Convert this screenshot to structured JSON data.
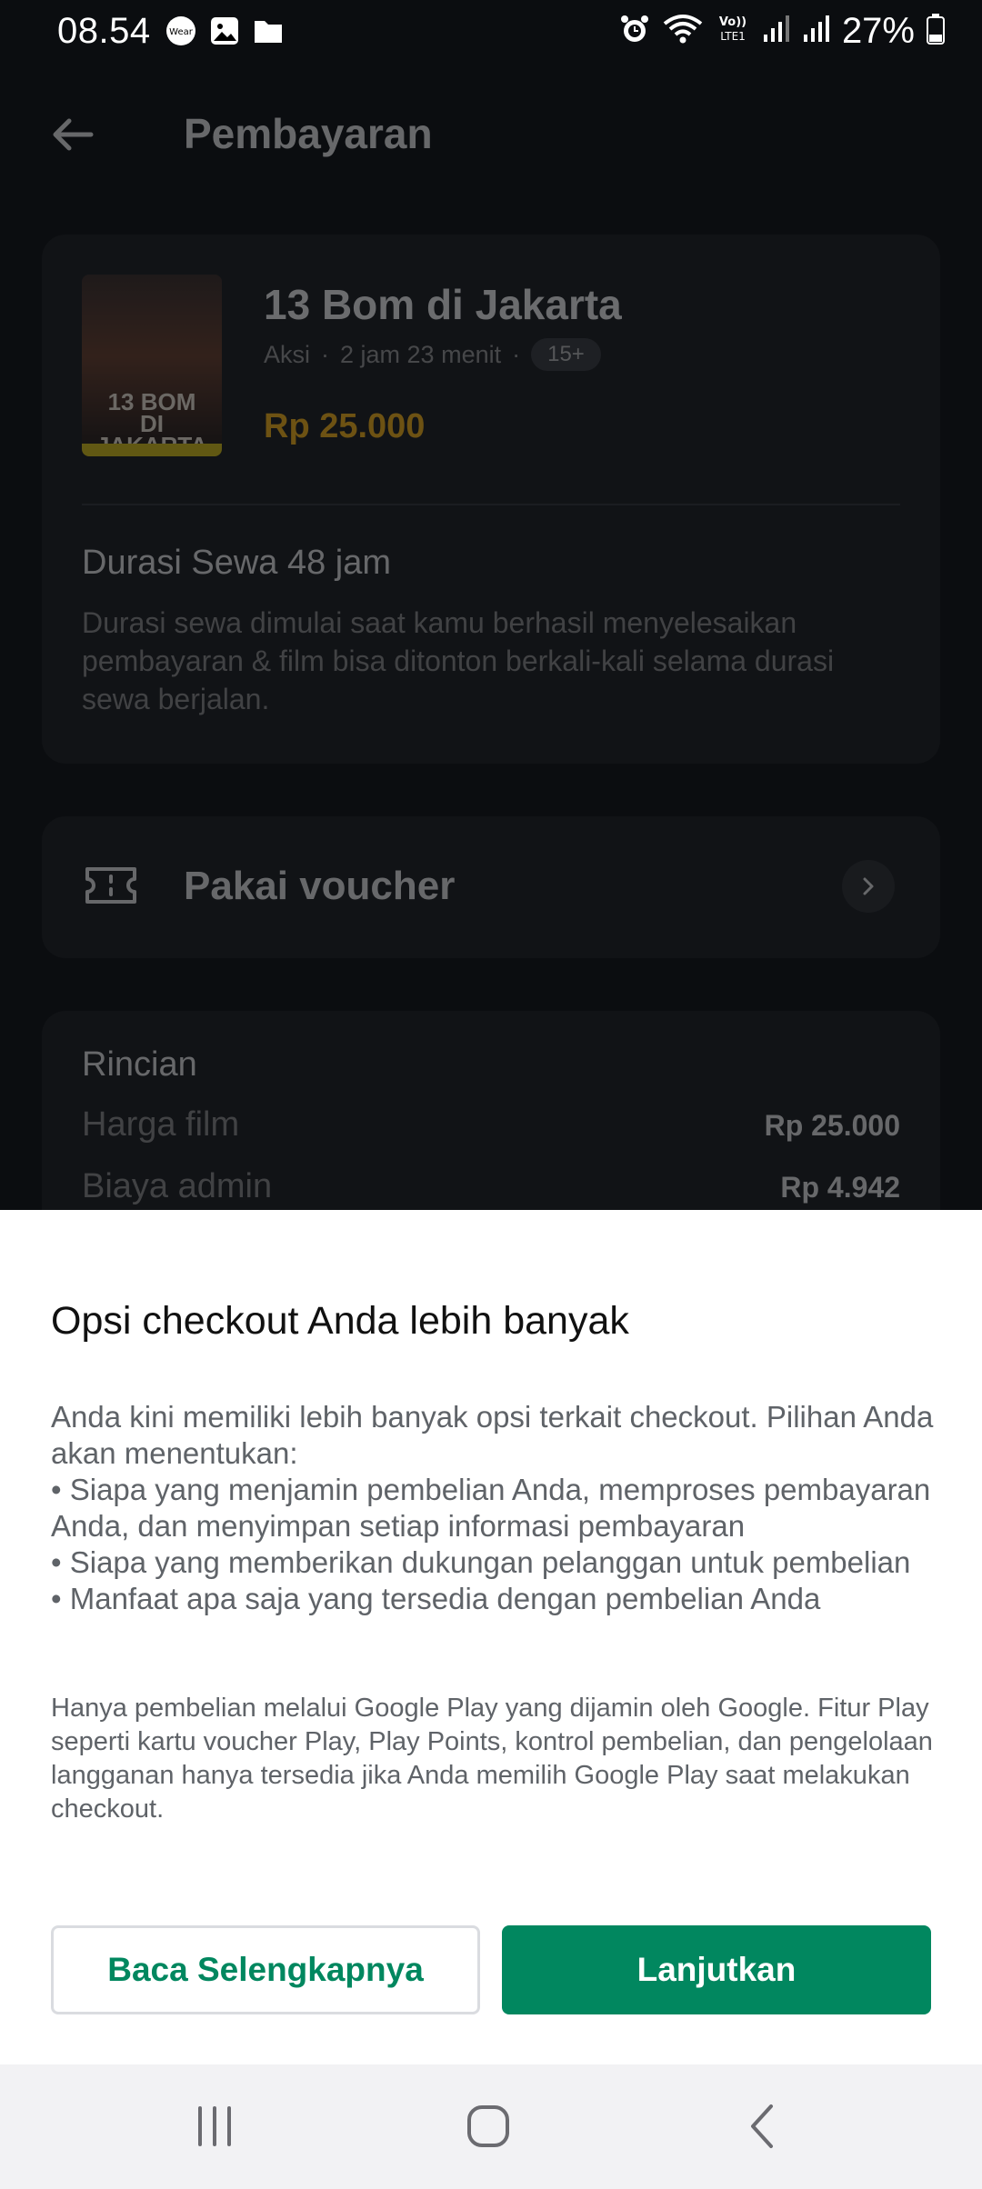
{
  "status_bar": {
    "time": "08.54",
    "battery": "27%",
    "left_icons": [
      "wear-icon",
      "image-icon",
      "folder-icon"
    ],
    "right_icons": [
      "alarm-icon",
      "wifi-icon",
      "volte-icon",
      "signal-icon",
      "signal-icon",
      "battery-icon"
    ]
  },
  "header": {
    "title": "Pembayaran"
  },
  "movie": {
    "poster_text": "13 BOM\nDI JAKARTA",
    "title": "13 Bom di Jakarta",
    "genre": "Aksi",
    "length": "2 jam 23 menit",
    "rating": "15+",
    "price": "Rp 25.000",
    "rental_title": "Durasi Sewa 48 jam",
    "rental_desc": "Durasi sewa dimulai saat kamu berhasil menyelesaikan pembayaran & film bisa ditonton berkali-kali selama durasi sewa berjalan."
  },
  "voucher": {
    "label": "Pakai voucher"
  },
  "details": {
    "title": "Rincian",
    "rows": [
      {
        "label": "Harga film",
        "value": "Rp 25.000"
      },
      {
        "label": "Biaya admin",
        "value": "Rp 4.942"
      }
    ]
  },
  "sheet": {
    "title": "Opsi checkout Anda lebih banyak",
    "intro": "Anda kini memiliki lebih banyak opsi terkait checkout. Pilihan Anda akan menentukan:",
    "bullets": [
      "• Siapa yang menjamin pembelian Anda, memproses pembayaran Anda, dan menyimpan setiap informasi pembayaran",
      "• Siapa yang memberikan dukungan pelanggan untuk pembelian",
      "• Manfaat apa saja yang tersedia dengan pembelian Anda"
    ],
    "note": "Hanya pembelian melalui Google Play yang dijamin oleh Google. Fitur Play seperti kartu voucher Play, Play Points, kontrol pembelian, dan pengelolaan langganan hanya tersedia jika Anda memilih Google Play saat melakukan checkout.",
    "learn_more": "Baca Selengkapnya",
    "continue": "Lanjutkan"
  },
  "colors": {
    "accent": "#01875f",
    "price": "#f6b21a"
  }
}
